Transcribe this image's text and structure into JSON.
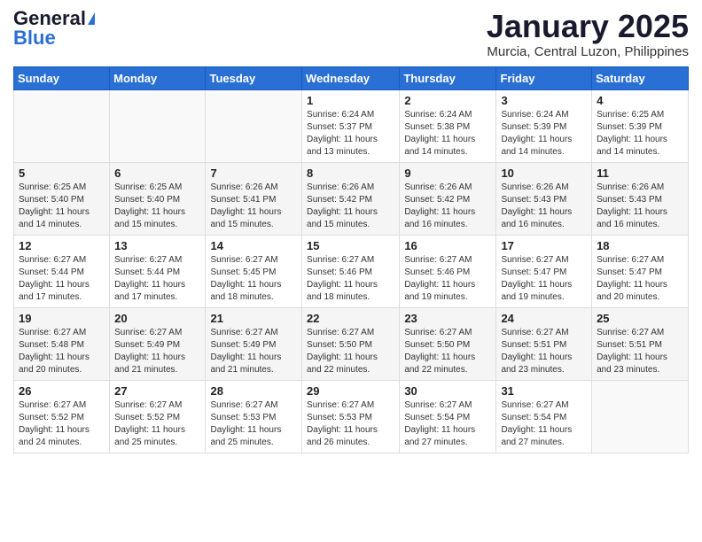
{
  "logo": {
    "general": "General",
    "blue": "Blue"
  },
  "title": {
    "month": "January 2025",
    "location": "Murcia, Central Luzon, Philippines"
  },
  "days_of_week": [
    "Sunday",
    "Monday",
    "Tuesday",
    "Wednesday",
    "Thursday",
    "Friday",
    "Saturday"
  ],
  "weeks": [
    [
      {
        "day": "",
        "info": ""
      },
      {
        "day": "",
        "info": ""
      },
      {
        "day": "",
        "info": ""
      },
      {
        "day": "1",
        "info": "Sunrise: 6:24 AM\nSunset: 5:37 PM\nDaylight: 11 hours and 13 minutes."
      },
      {
        "day": "2",
        "info": "Sunrise: 6:24 AM\nSunset: 5:38 PM\nDaylight: 11 hours and 14 minutes."
      },
      {
        "day": "3",
        "info": "Sunrise: 6:24 AM\nSunset: 5:39 PM\nDaylight: 11 hours and 14 minutes."
      },
      {
        "day": "4",
        "info": "Sunrise: 6:25 AM\nSunset: 5:39 PM\nDaylight: 11 hours and 14 minutes."
      }
    ],
    [
      {
        "day": "5",
        "info": "Sunrise: 6:25 AM\nSunset: 5:40 PM\nDaylight: 11 hours and 14 minutes."
      },
      {
        "day": "6",
        "info": "Sunrise: 6:25 AM\nSunset: 5:40 PM\nDaylight: 11 hours and 15 minutes."
      },
      {
        "day": "7",
        "info": "Sunrise: 6:26 AM\nSunset: 5:41 PM\nDaylight: 11 hours and 15 minutes."
      },
      {
        "day": "8",
        "info": "Sunrise: 6:26 AM\nSunset: 5:42 PM\nDaylight: 11 hours and 15 minutes."
      },
      {
        "day": "9",
        "info": "Sunrise: 6:26 AM\nSunset: 5:42 PM\nDaylight: 11 hours and 16 minutes."
      },
      {
        "day": "10",
        "info": "Sunrise: 6:26 AM\nSunset: 5:43 PM\nDaylight: 11 hours and 16 minutes."
      },
      {
        "day": "11",
        "info": "Sunrise: 6:26 AM\nSunset: 5:43 PM\nDaylight: 11 hours and 16 minutes."
      }
    ],
    [
      {
        "day": "12",
        "info": "Sunrise: 6:27 AM\nSunset: 5:44 PM\nDaylight: 11 hours and 17 minutes."
      },
      {
        "day": "13",
        "info": "Sunrise: 6:27 AM\nSunset: 5:44 PM\nDaylight: 11 hours and 17 minutes."
      },
      {
        "day": "14",
        "info": "Sunrise: 6:27 AM\nSunset: 5:45 PM\nDaylight: 11 hours and 18 minutes."
      },
      {
        "day": "15",
        "info": "Sunrise: 6:27 AM\nSunset: 5:46 PM\nDaylight: 11 hours and 18 minutes."
      },
      {
        "day": "16",
        "info": "Sunrise: 6:27 AM\nSunset: 5:46 PM\nDaylight: 11 hours and 19 minutes."
      },
      {
        "day": "17",
        "info": "Sunrise: 6:27 AM\nSunset: 5:47 PM\nDaylight: 11 hours and 19 minutes."
      },
      {
        "day": "18",
        "info": "Sunrise: 6:27 AM\nSunset: 5:47 PM\nDaylight: 11 hours and 20 minutes."
      }
    ],
    [
      {
        "day": "19",
        "info": "Sunrise: 6:27 AM\nSunset: 5:48 PM\nDaylight: 11 hours and 20 minutes."
      },
      {
        "day": "20",
        "info": "Sunrise: 6:27 AM\nSunset: 5:49 PM\nDaylight: 11 hours and 21 minutes."
      },
      {
        "day": "21",
        "info": "Sunrise: 6:27 AM\nSunset: 5:49 PM\nDaylight: 11 hours and 21 minutes."
      },
      {
        "day": "22",
        "info": "Sunrise: 6:27 AM\nSunset: 5:50 PM\nDaylight: 11 hours and 22 minutes."
      },
      {
        "day": "23",
        "info": "Sunrise: 6:27 AM\nSunset: 5:50 PM\nDaylight: 11 hours and 22 minutes."
      },
      {
        "day": "24",
        "info": "Sunrise: 6:27 AM\nSunset: 5:51 PM\nDaylight: 11 hours and 23 minutes."
      },
      {
        "day": "25",
        "info": "Sunrise: 6:27 AM\nSunset: 5:51 PM\nDaylight: 11 hours and 23 minutes."
      }
    ],
    [
      {
        "day": "26",
        "info": "Sunrise: 6:27 AM\nSunset: 5:52 PM\nDaylight: 11 hours and 24 minutes."
      },
      {
        "day": "27",
        "info": "Sunrise: 6:27 AM\nSunset: 5:52 PM\nDaylight: 11 hours and 25 minutes."
      },
      {
        "day": "28",
        "info": "Sunrise: 6:27 AM\nSunset: 5:53 PM\nDaylight: 11 hours and 25 minutes."
      },
      {
        "day": "29",
        "info": "Sunrise: 6:27 AM\nSunset: 5:53 PM\nDaylight: 11 hours and 26 minutes."
      },
      {
        "day": "30",
        "info": "Sunrise: 6:27 AM\nSunset: 5:54 PM\nDaylight: 11 hours and 27 minutes."
      },
      {
        "day": "31",
        "info": "Sunrise: 6:27 AM\nSunset: 5:54 PM\nDaylight: 11 hours and 27 minutes."
      },
      {
        "day": "",
        "info": ""
      }
    ]
  ]
}
